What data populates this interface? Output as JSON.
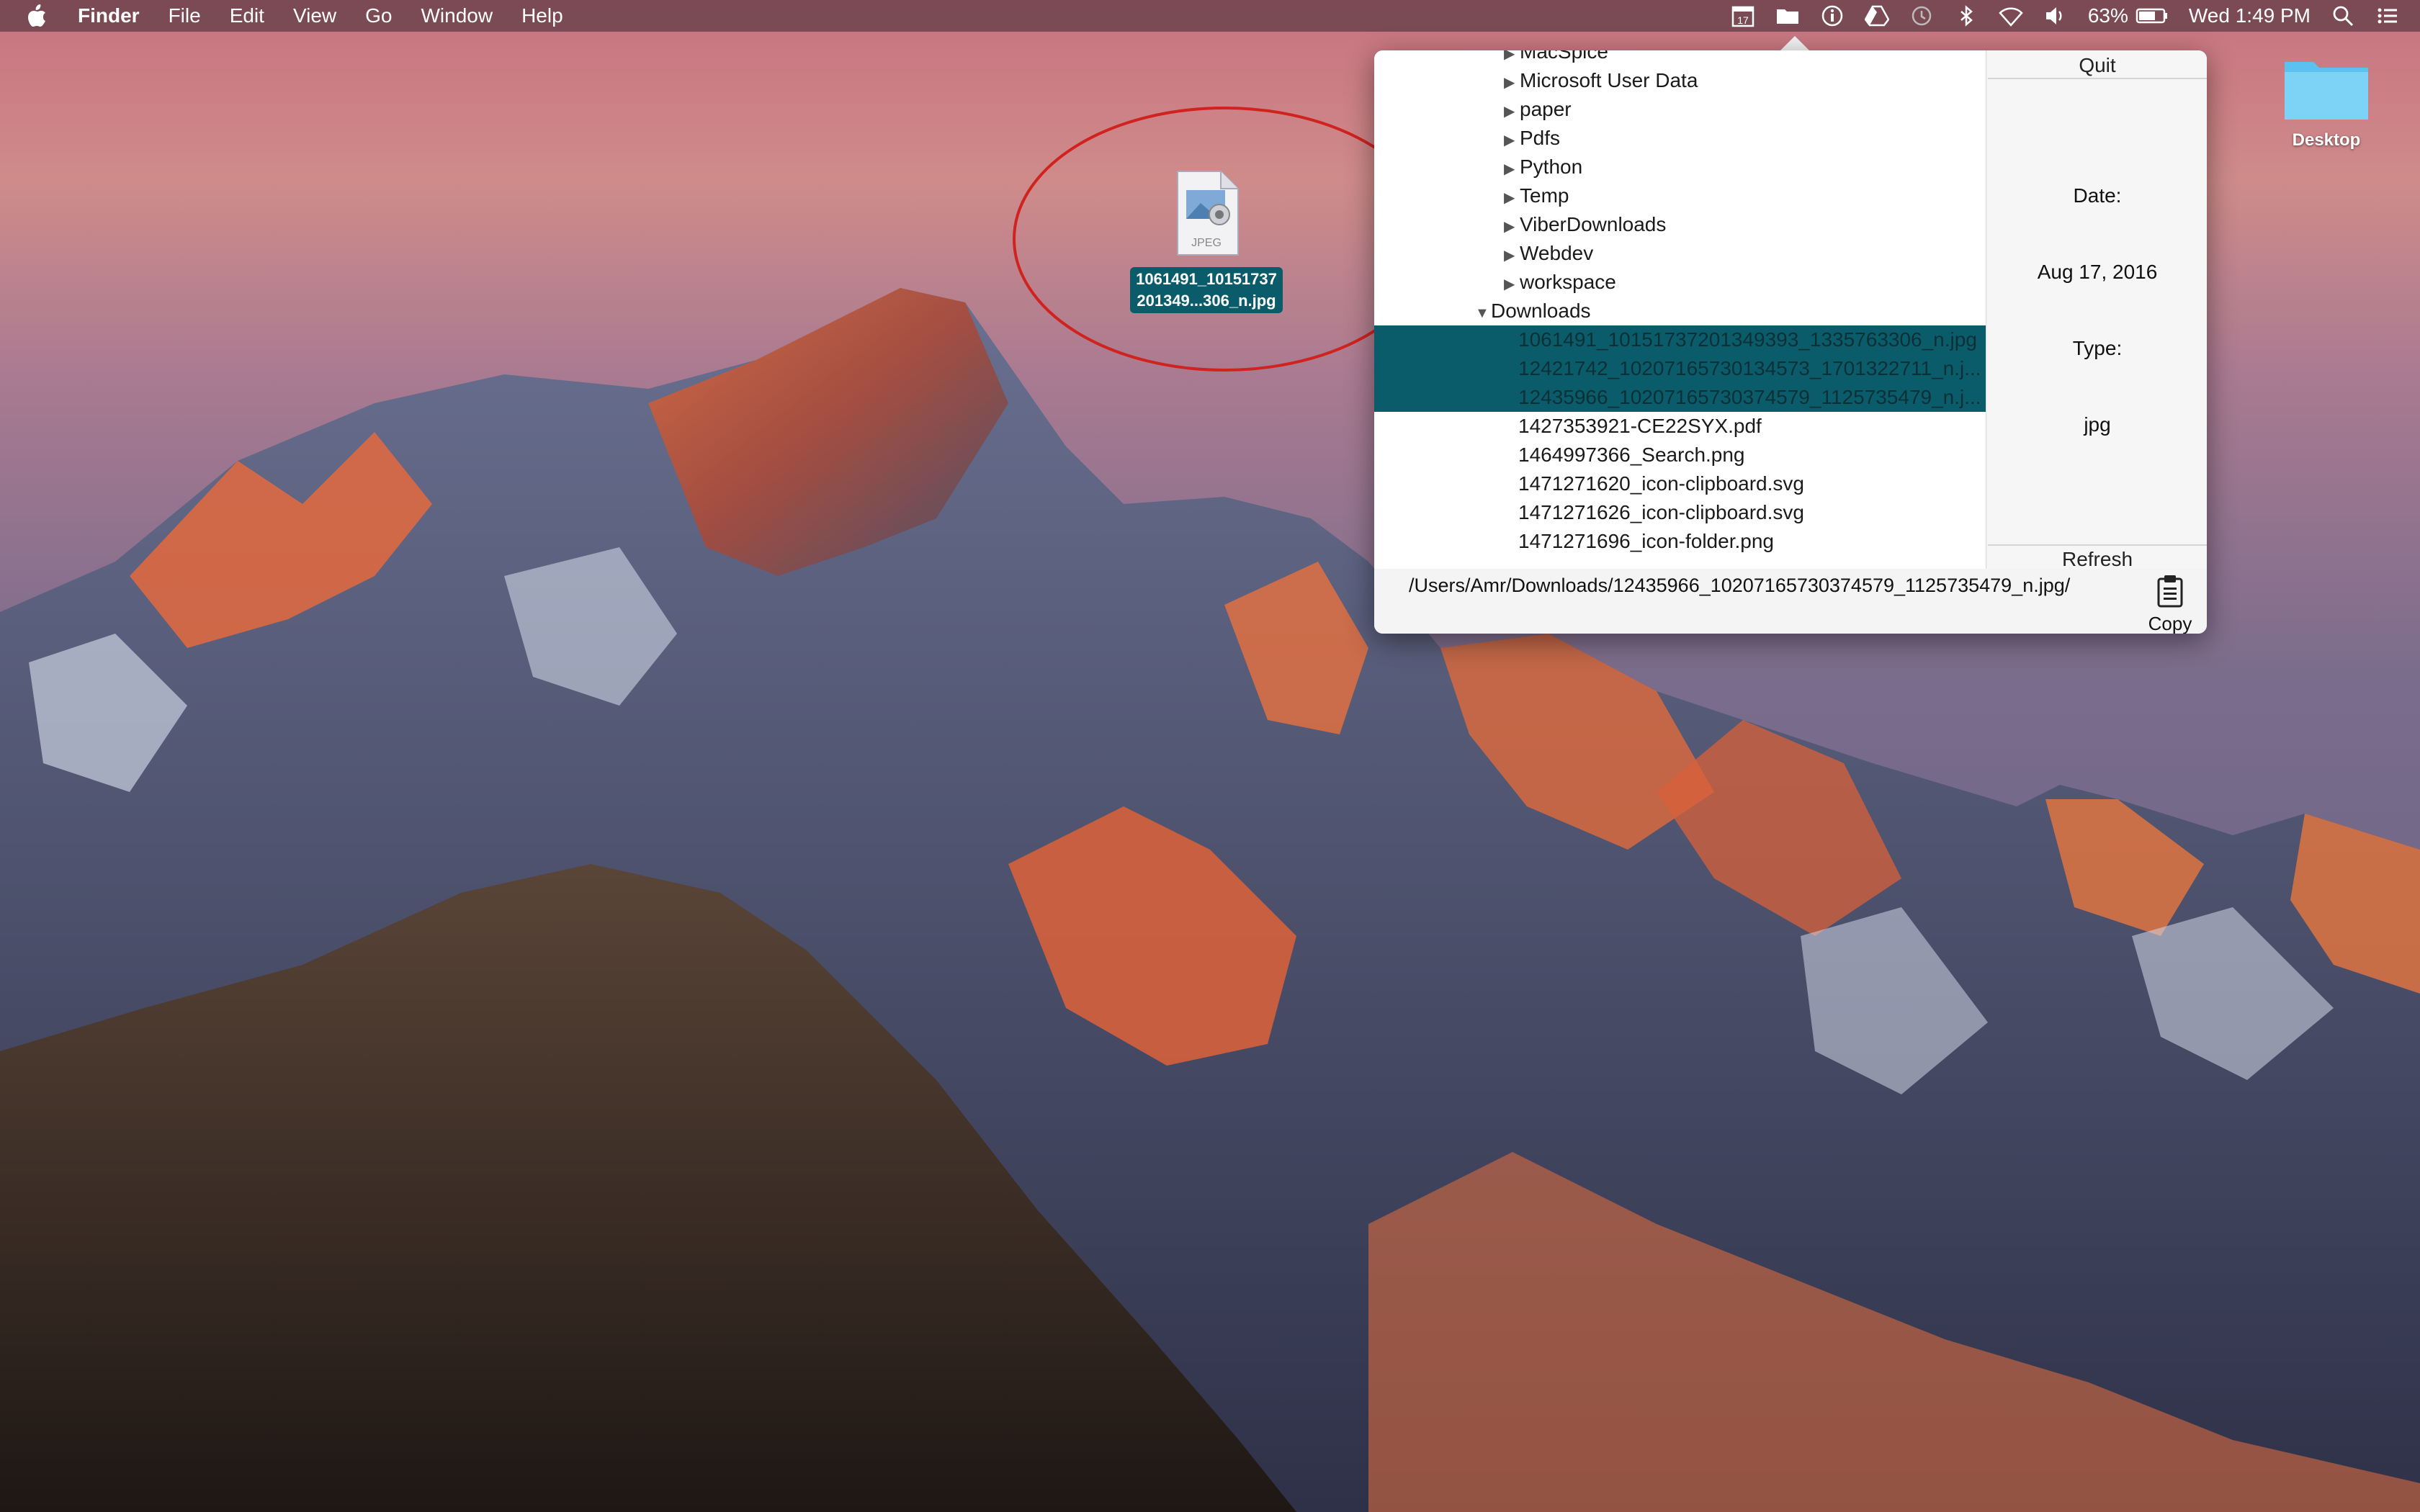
{
  "menubar": {
    "app": "Finder",
    "menus": [
      "File",
      "Edit",
      "View",
      "Go",
      "Window",
      "Help"
    ],
    "calendar_day": "17",
    "battery": "63%",
    "clock": "Wed 1:49 PM"
  },
  "desktop": {
    "file_icon": {
      "kind": "JPEG",
      "label_line1": "1061491_10151737",
      "label_line2": "201349...306_n.jpg"
    },
    "folder": {
      "label": "Desktop"
    }
  },
  "popover": {
    "tree": [
      {
        "indent": 3,
        "arrow": "collapsed",
        "label": "MacSpice",
        "selected": false
      },
      {
        "indent": 3,
        "arrow": "collapsed",
        "label": "Microsoft User Data",
        "selected": false
      },
      {
        "indent": 3,
        "arrow": "collapsed",
        "label": "paper",
        "selected": false
      },
      {
        "indent": 3,
        "arrow": "collapsed",
        "label": "Pdfs",
        "selected": false
      },
      {
        "indent": 3,
        "arrow": "collapsed",
        "label": "Python",
        "selected": false
      },
      {
        "indent": 3,
        "arrow": "collapsed",
        "label": "Temp",
        "selected": false
      },
      {
        "indent": 3,
        "arrow": "collapsed",
        "label": "ViberDownloads",
        "selected": false
      },
      {
        "indent": 3,
        "arrow": "collapsed",
        "label": "Webdev",
        "selected": false
      },
      {
        "indent": 3,
        "arrow": "collapsed",
        "label": "workspace",
        "selected": false
      },
      {
        "indent": 2,
        "arrow": "expanded",
        "label": "Downloads",
        "selected": false
      },
      {
        "indent": 4,
        "arrow": "none",
        "label": "1061491_10151737201349393_1335763306_n.jpg",
        "selected": true
      },
      {
        "indent": 4,
        "arrow": "none",
        "label": "12421742_10207165730134573_1701322711_n.j...",
        "selected": true
      },
      {
        "indent": 4,
        "arrow": "none",
        "label": "12435966_10207165730374579_1125735479_n.j...",
        "selected": true
      },
      {
        "indent": 4,
        "arrow": "none",
        "label": "1427353921-CE22SYX.pdf",
        "selected": false
      },
      {
        "indent": 4,
        "arrow": "none",
        "label": "1464997366_Search.png",
        "selected": false
      },
      {
        "indent": 4,
        "arrow": "none",
        "label": "1471271620_icon-clipboard.svg",
        "selected": false
      },
      {
        "indent": 4,
        "arrow": "none",
        "label": "1471271626_icon-clipboard.svg",
        "selected": false
      },
      {
        "indent": 4,
        "arrow": "none",
        "label": "1471271696_icon-folder.png",
        "selected": false
      }
    ],
    "quit_label": "Quit",
    "refresh_label": "Refresh",
    "date_label": "Date:",
    "date_value": "Aug 17, 2016",
    "type_label": "Type:",
    "type_value": "jpg",
    "path": "/Users/Amr/Downloads/12435966_10207165730374579_1125735479_n.jpg/",
    "copy_label": "Copy"
  },
  "colors": {
    "selection": "#0b5c6b",
    "annotation": "#d0231f",
    "folder": "#5bc2ef"
  }
}
